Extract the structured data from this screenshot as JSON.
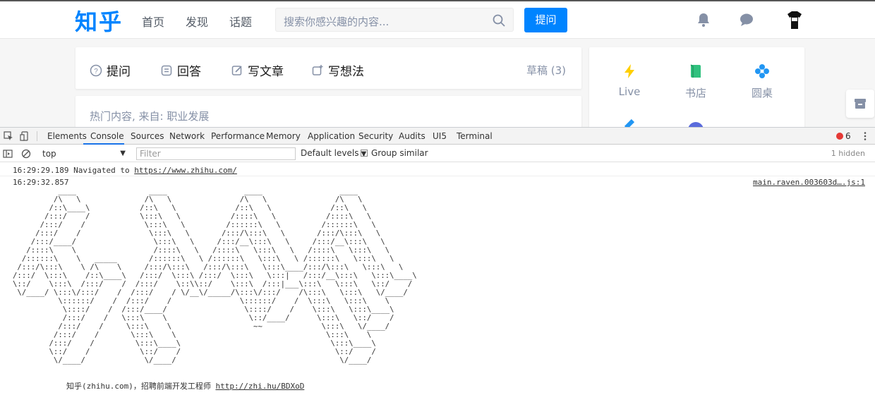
{
  "site": {
    "logo": "知乎",
    "nav": [
      "首页",
      "发现",
      "话题"
    ],
    "search_placeholder": "搜索你感兴趣的内容...",
    "ask_button": "提问"
  },
  "write_bar": {
    "items": [
      "提问",
      "回答",
      "写文章",
      "写想法"
    ],
    "draft": "草稿 (3)"
  },
  "hot": {
    "text": "热门内容, 来自: 职业发展"
  },
  "side": {
    "items": [
      "Live",
      "书店",
      "圆桌"
    ]
  },
  "colors": {
    "accent": "#0084ff",
    "devtools_active": "#1a73e8",
    "error": "#e53935"
  },
  "devtools": {
    "tabs": [
      "Elements",
      "Console",
      "Sources",
      "Network",
      "Performance",
      "Memory",
      "Application",
      "Security",
      "Audits",
      "UI5",
      "Terminal"
    ],
    "active_tab": "Console",
    "error_count": "6",
    "context": "top",
    "filter_placeholder": "Filter",
    "levels": "Default levels",
    "group_similar": "Group similar",
    "hidden": "1 hidden"
  },
  "console": {
    "nav_time": "16:29:29.189",
    "nav_text": "Navigated to",
    "nav_url": "https://www.zhihu.com/",
    "log_time": "16:29:32.857",
    "log_source": "main.raven.003603d….js:1",
    "ascii_art": "          ____                ____                 ____                 ____\n         /\\   \\              /\\   \\               /\\   \\               /\\   \\\n        /::\\____\\           /::\\   \\             /::\\   \\             /::\\   \\\n       /:::/    /           \\:::\\   \\           /::::\\   \\           /::::\\   \\\n      /:::/    /             \\:::\\   \\         /::::::\\   \\         /::::::\\   \\\n     /:::/    /               \\:::\\   \\       /:::/\\:::\\   \\       /:::/\\:::\\   \\\n    /:::/____/                 \\:::\\   \\     /:::/__\\:::\\   \\     /:::/__\\:::\\   \\\n   /::::\\    \\                 /::::\\   \\   /::::\\   \\:::\\   \\   /::::\\   \\:::\\   \\\n  /::::::\\    \\   _____       /::::::\\   \\ /::::::\\   \\:::\\   \\ /::::::\\   \\:::\\   \\\n /:::/\\:::\\    \\ /\\    \\     /:::/\\:::\\   /:::/\\:::\\   \\:::\\____/:::/\\:::\\   \\:::\\   \\\n/:::/  \\:::\\    /::\\____\\   /:::/  \\:::\\ /:::/  \\:::\\   \\:::|   /:::/__\\:::\\   \\:::\\____\\\n\\::/    \\:::\\  /:::/    /  /:::/    \\::\\\\::/    \\:::\\  /:::|___\\:::\\   \\:::\\   \\::/    /\n \\/____/ \\:::\\/:::/    /  /:::/    / \\/__\\/_____/\\:::\\/:::/    /\\:::\\   \\:::\\   \\/____/\n          \\::::::/    /  /:::/    /               \\::::::/    /  \\:::\\   \\:::\\    \\\n           \\::::/    /  /:::/____/                 \\::::/    /    \\:::\\   \\:::\\____\\\n           /:::/    /   \\:::\\    \\                  \\::/____/      \\:::\\   \\::/    /\n          /:::/    /     \\:::\\    \\                  ~~             \\:::\\   \\/____/\n         /:::/    /       \\:::\\    \\                                 \\:::\\    \\\n        /:::/    /         \\:::\\____\\                                 \\:::\\____\\\n        \\::/    /           \\::/    /                                  \\::/    /\n         \\/____/             \\/____/                                    \\/____/",
    "recruit_text": "知乎(zhihu.com)，招聘前端开发工程师",
    "recruit_url": "http://zhi.hu/BDXoD"
  }
}
